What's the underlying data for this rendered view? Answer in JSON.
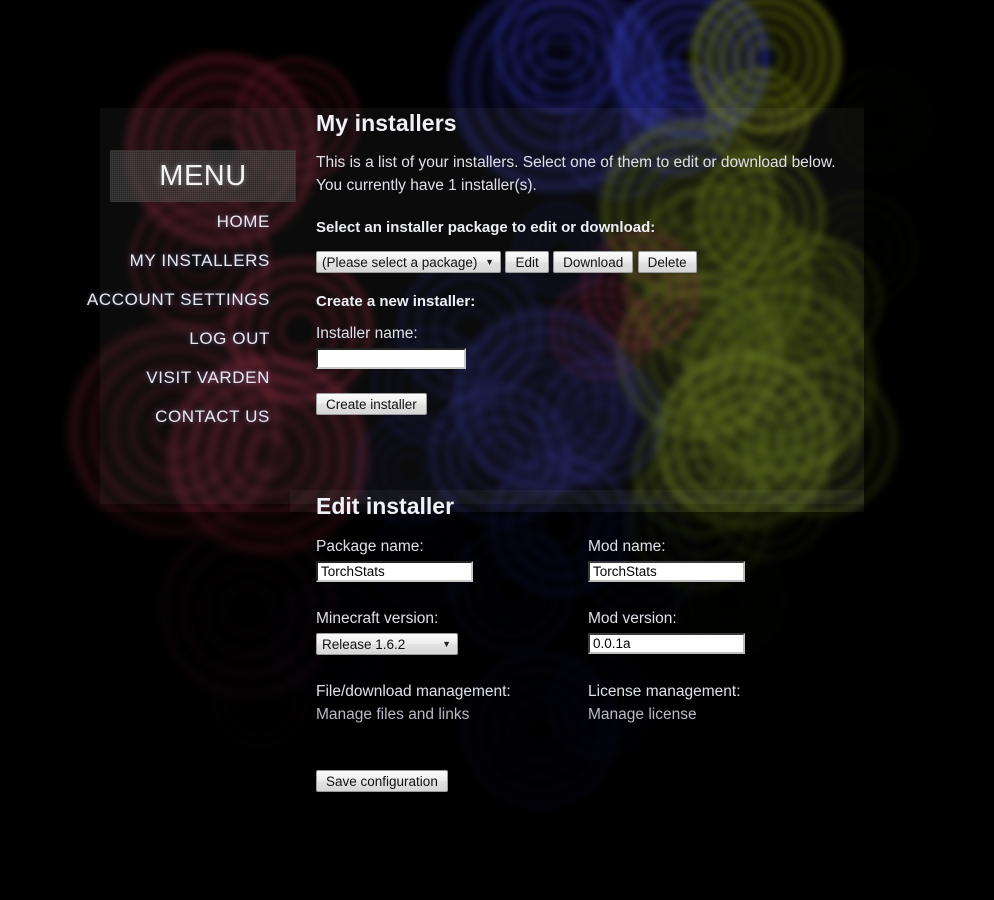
{
  "sidebar": {
    "header": "MENU",
    "items": [
      {
        "label": "HOME",
        "name": "home"
      },
      {
        "label": "MY INSTALLERS",
        "name": "my-installers"
      },
      {
        "label": "ACCOUNT SETTINGS",
        "name": "account-settings"
      },
      {
        "label": "LOG OUT",
        "name": "log-out"
      },
      {
        "label": "VISIT VARDEN",
        "name": "visit-varden"
      },
      {
        "label": "CONTACT US",
        "name": "contact-us"
      }
    ]
  },
  "main": {
    "title": "My installers",
    "intro_line1": "This is a list of your installers. Select one of them to edit or download below.",
    "intro_line2": "You currently have 1 installer(s).",
    "select_section_label": "Select an installer package to edit or download:",
    "package_select": {
      "selected": "(Please select a package)",
      "options": [
        "(Please select a package)"
      ]
    },
    "buttons": {
      "edit": "Edit",
      "download": "Download",
      "delete": "Delete"
    },
    "create_section_label": "Create a new installer:",
    "installer_name_label": "Installer name:",
    "installer_name_value": "",
    "create_button": "Create installer"
  },
  "edit": {
    "title": "Edit installer",
    "package_name_label": "Package name:",
    "package_name_value": "TorchStats",
    "mod_name_label": "Mod name:",
    "mod_name_value": "TorchStats",
    "minecraft_version_label": "Minecraft version:",
    "minecraft_version_selected": "Release 1.6.2",
    "minecraft_version_options": [
      "Release 1.6.2"
    ],
    "mod_version_label": "Mod version:",
    "mod_version_value": "0.0.1a",
    "file_management_label": "File/download management:",
    "file_management_link": "Manage files and links",
    "license_management_label": "License management:",
    "license_management_link": "Manage license",
    "save_button": "Save configuration"
  },
  "icons": {
    "dropdown_caret": "▼"
  },
  "theme": {
    "page_background": "#000000",
    "text_primary": "#e8e9ef",
    "text_muted": "#b9bac4",
    "button_face": "#ededed",
    "input_background": "#ffffff"
  }
}
